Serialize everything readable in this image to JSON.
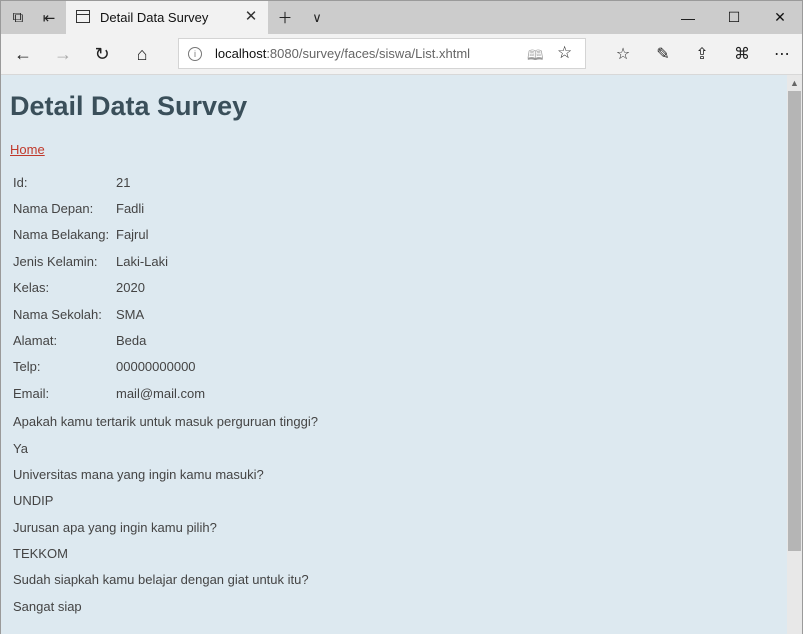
{
  "browser": {
    "tab_title": "Detail Data Survey",
    "url_host": "localhost",
    "url_rest": ":8080/survey/faces/siswa/List.xhtml"
  },
  "page": {
    "title": "Detail Data Survey",
    "home_link": "Home"
  },
  "fields": [
    {
      "label": "Id:",
      "value": "21"
    },
    {
      "label": "Nama Depan:",
      "value": "Fadli"
    },
    {
      "label": "Nama Belakang:",
      "value": "Fajrul"
    },
    {
      "label": "Jenis Kelamin:",
      "value": "Laki-Laki"
    },
    {
      "label": "Kelas:",
      "value": "2020"
    },
    {
      "label": "Nama Sekolah:",
      "value": "SMA"
    },
    {
      "label": "Alamat:",
      "value": "Beda"
    },
    {
      "label": "Telp:",
      "value": "00000000000"
    },
    {
      "label": "Email:",
      "value": "mail@mail.com"
    }
  ],
  "survey": [
    {
      "question": "Apakah kamu tertarik untuk masuk perguruan tinggi?",
      "answer": "Ya"
    },
    {
      "question": "Universitas mana yang ingin kamu masuki?",
      "answer": "UNDIP"
    },
    {
      "question": "Jurusan apa yang ingin kamu pilih?",
      "answer": "TEKKOM"
    },
    {
      "question": "Sudah siapkah kamu belajar dengan giat untuk itu?",
      "answer": "Sangat siap"
    }
  ]
}
